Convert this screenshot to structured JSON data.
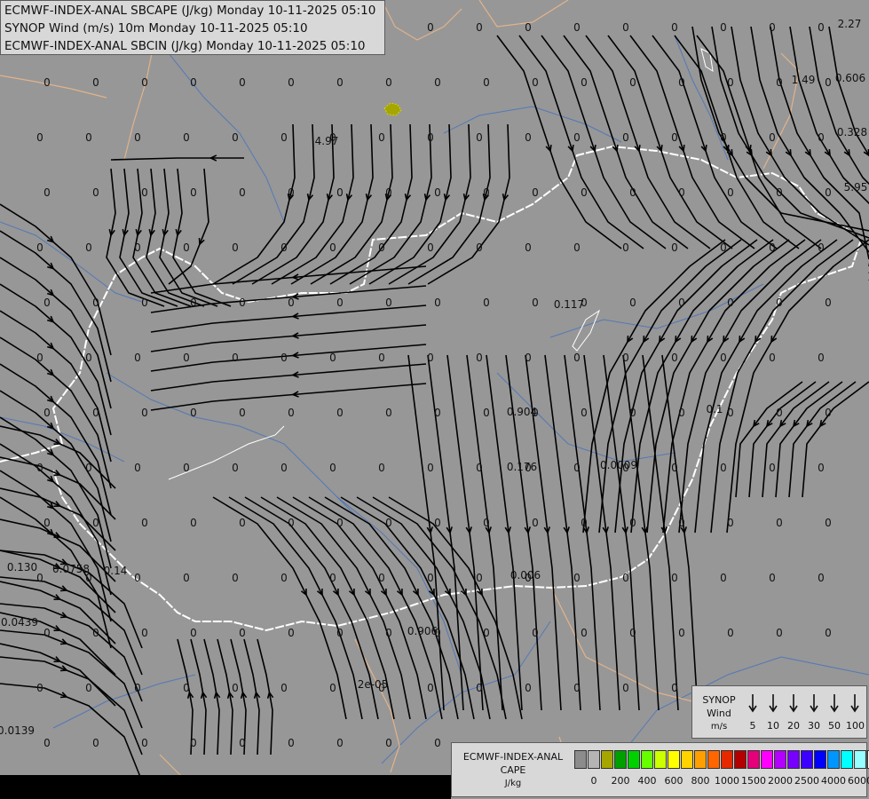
{
  "info_panel": {
    "line1": "ECMWF-INDEX-ANAL SBCAPE (J/kg) Monday 10-11-2025 05:10",
    "line2": "SYNOP Wind (m/s) 10m Monday 10-11-2025 05:10",
    "line3": "ECMWF-INDEX-ANAL SBCIN (J/kg) Monday 10-11-2025 05:10"
  },
  "wind_legend": {
    "title_line1": "SYNOP",
    "title_line2": "Wind",
    "title_line3": "m/s",
    "values": [
      "5",
      "10",
      "20",
      "30",
      "50",
      "100"
    ]
  },
  "cape_legend": {
    "title_line1": "ECMWF-INDEX-ANAL",
    "title_line2": "CAPE",
    "title_line3": "J/kg",
    "tick_labels": [
      "0",
      "200",
      "400",
      "600",
      "800",
      "1000",
      "1500",
      "2000",
      "2500",
      "4000",
      "6000"
    ],
    "colors": [
      "#8c8c8c",
      "#b4b4b4",
      "#a6a600",
      "#00a000",
      "#00d000",
      "#66ff00",
      "#ccff00",
      "#ffff00",
      "#ffd200",
      "#ffa000",
      "#ff6600",
      "#e62800",
      "#b40000",
      "#e6007a",
      "#ff00ff",
      "#b400ff",
      "#7800ff",
      "#3c00ff",
      "#0000ff",
      "#0096ff",
      "#00ffff",
      "#96ffff",
      "#ffffff"
    ]
  },
  "colors": {
    "background": "#979797",
    "border_country": "#ffffff",
    "border_region": "#e2b38a",
    "rivers": "#3d6fbf",
    "streamlines": "#000000"
  },
  "map_labels": [
    "0.0139",
    "0.0439",
    "0.130",
    "0.0758",
    "0.14",
    "2e-05",
    "0.906",
    "0.006",
    "0.176",
    "0.0009",
    "0.904",
    "0.117",
    "4.97",
    "1.49",
    "0.606",
    "0.328",
    "5.95",
    "2.27",
    "0.1"
  ]
}
